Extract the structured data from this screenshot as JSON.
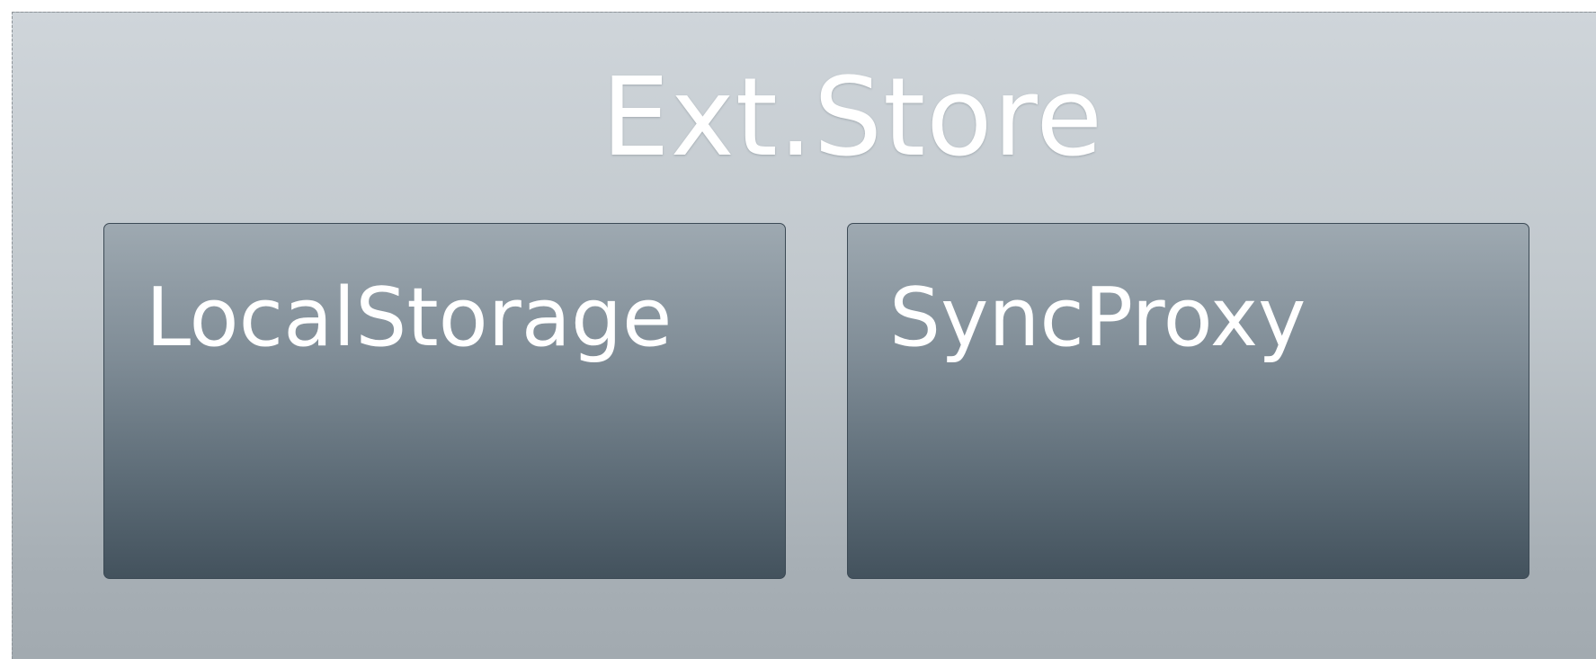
{
  "diagram": {
    "title": "Ext.Store",
    "components": [
      {
        "label": "LocalStorage"
      },
      {
        "label": "SyncProxy"
      }
    ]
  }
}
